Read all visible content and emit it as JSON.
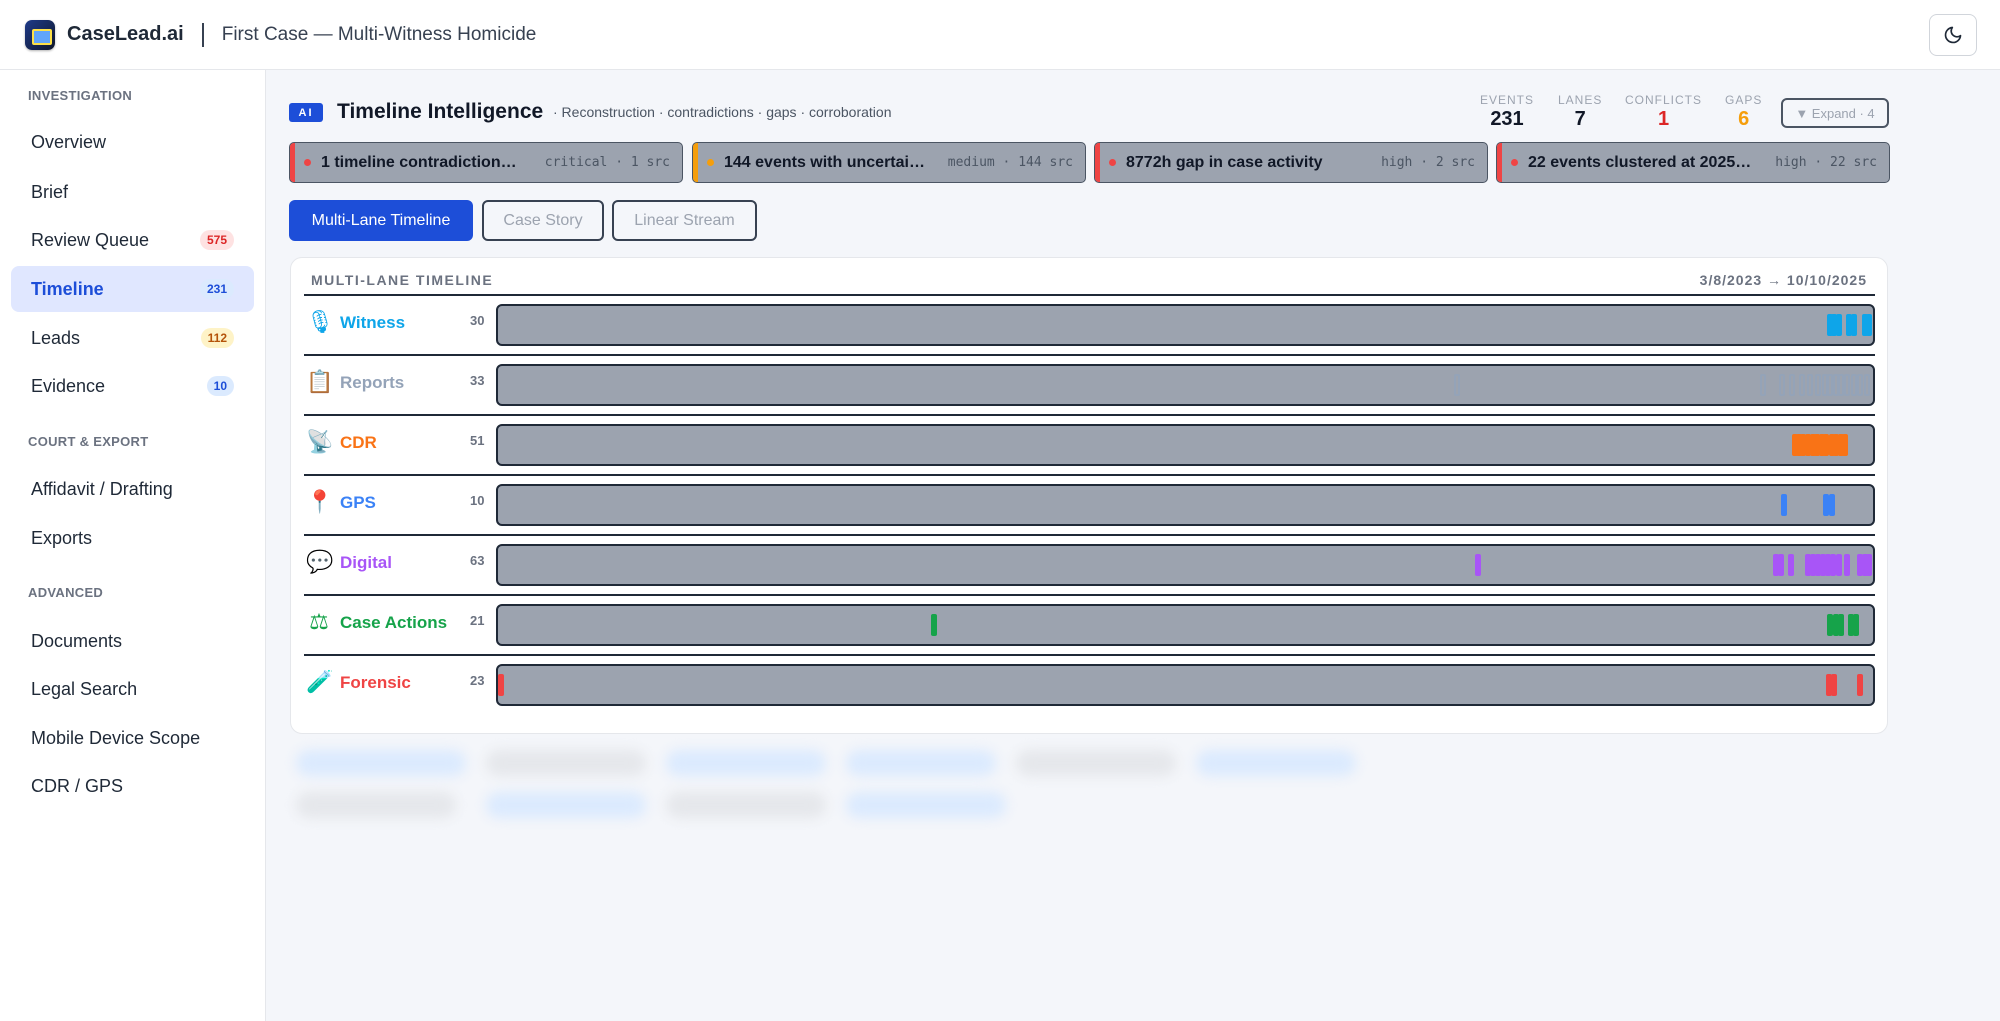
{
  "app": {
    "brand": "CaseLead.ai",
    "case_title": "First Case — Multi-Witness Homicide",
    "theme_icon": "moon-icon"
  },
  "sidebar": {
    "sections": {
      "investigation": "INVESTIGATION",
      "court_export": "COURT & EXPORT",
      "advanced": "ADVANCED"
    },
    "items": [
      {
        "label": "Overview"
      },
      {
        "label": "Brief"
      },
      {
        "label": "Review Queue",
        "badge": "575"
      },
      {
        "label": "Timeline",
        "badge": "231",
        "active": true
      },
      {
        "label": "Leads",
        "badge": "112"
      },
      {
        "label": "Evidence",
        "badge": "10"
      },
      {
        "label": "Affidavit / Drafting"
      },
      {
        "label": "Exports"
      },
      {
        "label": "Documents"
      },
      {
        "label": "Legal Search"
      },
      {
        "label": "Mobile Device Scope"
      },
      {
        "label": "CDR / GPS"
      }
    ]
  },
  "header": {
    "ai_badge": "AI",
    "title": "Timeline Intelligence",
    "subtitle": "· Reconstruction · contradictions · gaps · corroboration",
    "stats": [
      {
        "label": "EVENTS",
        "value": "231",
        "color": "#111827"
      },
      {
        "label": "LANES",
        "value": "7",
        "color": "#111827"
      },
      {
        "label": "CONFLICTS",
        "value": "1",
        "color": "#dc2626"
      },
      {
        "label": "GAPS",
        "value": "6",
        "color": "#f59e0b"
      }
    ],
    "expand_label": "▼ Expand · 4"
  },
  "alerts": [
    {
      "text": "1 timeline contradiction…",
      "meta": "critical · 1 src",
      "color": "#ef4444"
    },
    {
      "text": "144 events with uncertai…",
      "meta": "medium · 144 src",
      "color": "#f59e0b"
    },
    {
      "text": "8772h gap in case activity",
      "meta": "high · 2 src",
      "color": "#ef4444"
    },
    {
      "text": "22 events clustered at 2025…",
      "meta": "high · 22 src",
      "color": "#ef4444"
    }
  ],
  "tabs": [
    {
      "label": "Multi-Lane Timeline",
      "active": true
    },
    {
      "label": "Case Story"
    },
    {
      "label": "Linear Stream"
    }
  ],
  "timeline": {
    "heading": "MULTI-LANE TIMELINE",
    "range": "3/8/2023 → 10/10/2025",
    "lanes": [
      {
        "name": "Witness",
        "count": "30",
        "icon": "microphone-icon",
        "glyph": "🎙",
        "color": "#0ea5e9",
        "events": [
          0.971,
          0.974,
          0.977,
          0.985,
          0.988,
          0.996,
          0.999
        ],
        "outline": false
      },
      {
        "name": "Reports",
        "count": "33",
        "icon": "clipboard-icon",
        "glyph": "📋",
        "color": "#94a3b8",
        "events": [
          0.698,
          0.922,
          0.936,
          0.943,
          0.95,
          0.956,
          0.962,
          0.967,
          0.971,
          0.975,
          0.979,
          0.983,
          0.988,
          0.993,
          0.998
        ],
        "outline": true
      },
      {
        "name": "CDR",
        "count": "51",
        "icon": "satellite-dish-icon",
        "glyph": "📡",
        "color": "#f97316",
        "events": [
          0.945,
          0.948,
          0.951,
          0.955,
          0.958,
          0.961,
          0.965,
          0.968,
          0.972,
          0.975,
          0.979,
          0.982
        ],
        "outline": false
      },
      {
        "name": "GPS",
        "count": "10",
        "icon": "map-pin-icon",
        "glyph": "📍",
        "color": "#3b82f6",
        "events": [
          0.937,
          0.968,
          0.972
        ],
        "outline": false
      },
      {
        "name": "Digital",
        "count": "63",
        "icon": "chat-bubble-icon",
        "glyph": "💬",
        "color": "#a855f7",
        "events": [
          0.714,
          0.931,
          0.935,
          0.942,
          0.955,
          0.958,
          0.962,
          0.966,
          0.969,
          0.973,
          0.977,
          0.983,
          0.993,
          0.996,
          0.999
        ],
        "outline": false
      },
      {
        "name": "Case Actions",
        "count": "21",
        "icon": "scales-icon",
        "glyph": "⚖",
        "color": "#16a34a",
        "events": [
          0.316,
          0.971,
          0.975,
          0.979,
          0.986,
          0.99
        ],
        "outline": false
      },
      {
        "name": "Forensic",
        "count": "23",
        "icon": "test-tube-icon",
        "glyph": "🧪",
        "color": "#ef4444",
        "events": [
          0.0,
          0.97,
          0.974,
          0.993
        ],
        "outline": false
      }
    ]
  }
}
